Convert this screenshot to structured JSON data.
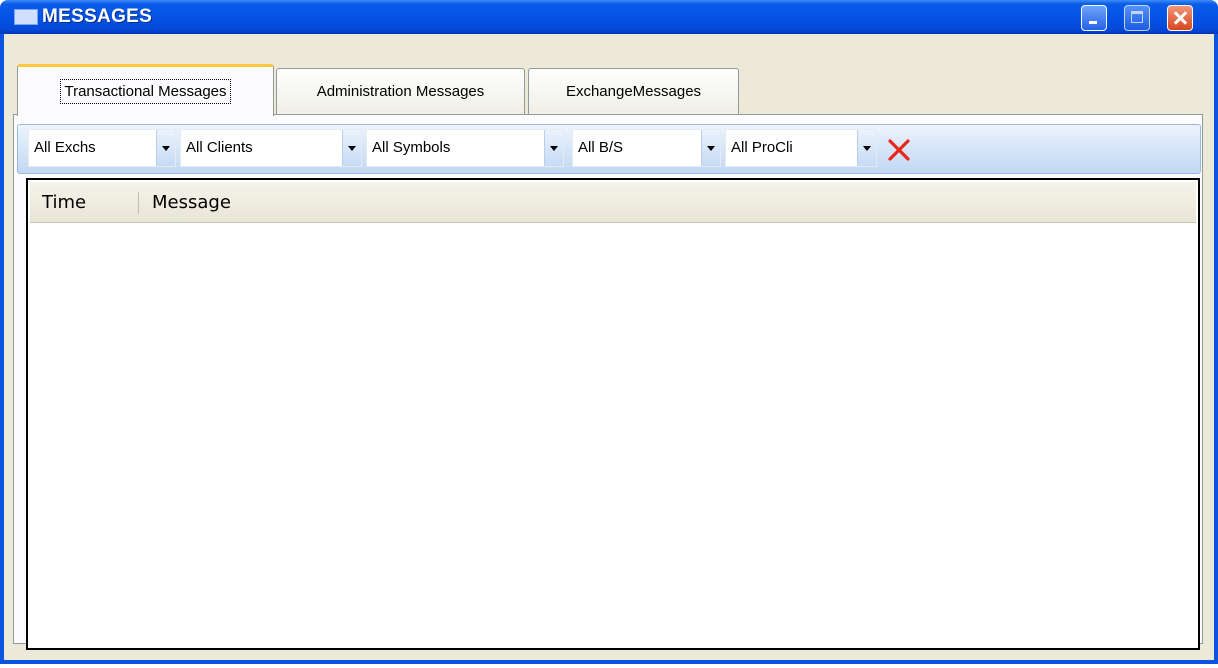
{
  "window": {
    "title": "MESSAGES",
    "icon": "envelope-icon",
    "controls": [
      "minimize-icon",
      "maximize-icon",
      "close-icon"
    ]
  },
  "tabs": [
    {
      "label": "Transactional Messages",
      "active": true
    },
    {
      "label": "Administration Messages",
      "active": false
    },
    {
      "label": "ExchangeMessages",
      "active": false
    }
  ],
  "filters": {
    "exchange": "All Exchs",
    "client": "All Clients",
    "symbol": "All Symbols",
    "buy_sell": "All B/S",
    "procli": "All ProCli",
    "clear_icon": "clear-filter-icon",
    "clear_color": "#e8261a"
  },
  "grid": {
    "columns": [
      "Time",
      "Message"
    ],
    "rows": []
  },
  "colors": {
    "titlebar": "#0553e6",
    "tab_highlight": "#ffc83c",
    "filterbar": "#d6e5f8"
  }
}
